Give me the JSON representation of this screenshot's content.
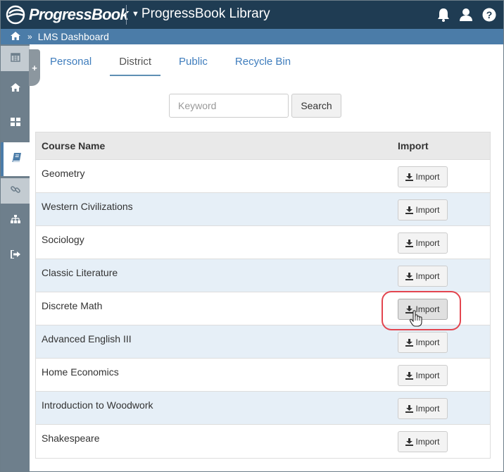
{
  "header": {
    "logo_text": "ProgressBook",
    "app_title": "ProgressBook Library",
    "icons": [
      "bell-icon",
      "user-icon",
      "help-icon"
    ]
  },
  "breadcrumb": {
    "home_icon": "home-icon",
    "current": "LMS Dashboard"
  },
  "nav": {
    "items": [
      "calendar-icon",
      "home-icon",
      "dashboard-icon",
      "book-icon",
      "link-icon",
      "sitemap-icon",
      "signout-icon"
    ],
    "active": "book-icon"
  },
  "tabs": [
    {
      "label": "Personal",
      "active": false
    },
    {
      "label": "District",
      "active": true
    },
    {
      "label": "Public",
      "active": false
    },
    {
      "label": "Recycle Bin",
      "active": false
    }
  ],
  "search": {
    "placeholder": "Keyword",
    "value": "",
    "button_label": "Search"
  },
  "table": {
    "columns": [
      "Course Name",
      "Import"
    ],
    "import_label": "Import",
    "rows": [
      "Geometry",
      "Western Civilizations",
      "Sociology",
      "Classic Literature",
      "Discrete Math",
      "Advanced English III",
      "Home Economics",
      "Introduction to Woodwork",
      "Shakespeare"
    ]
  },
  "colors": {
    "header_bg": "#1f3c53",
    "breadcrumb_bg": "#4b7ca8",
    "nav_bg": "#6e7f8c",
    "link": "#3f7dbd",
    "row_alt": "#e6eff7",
    "highlight": "#e3454f"
  }
}
